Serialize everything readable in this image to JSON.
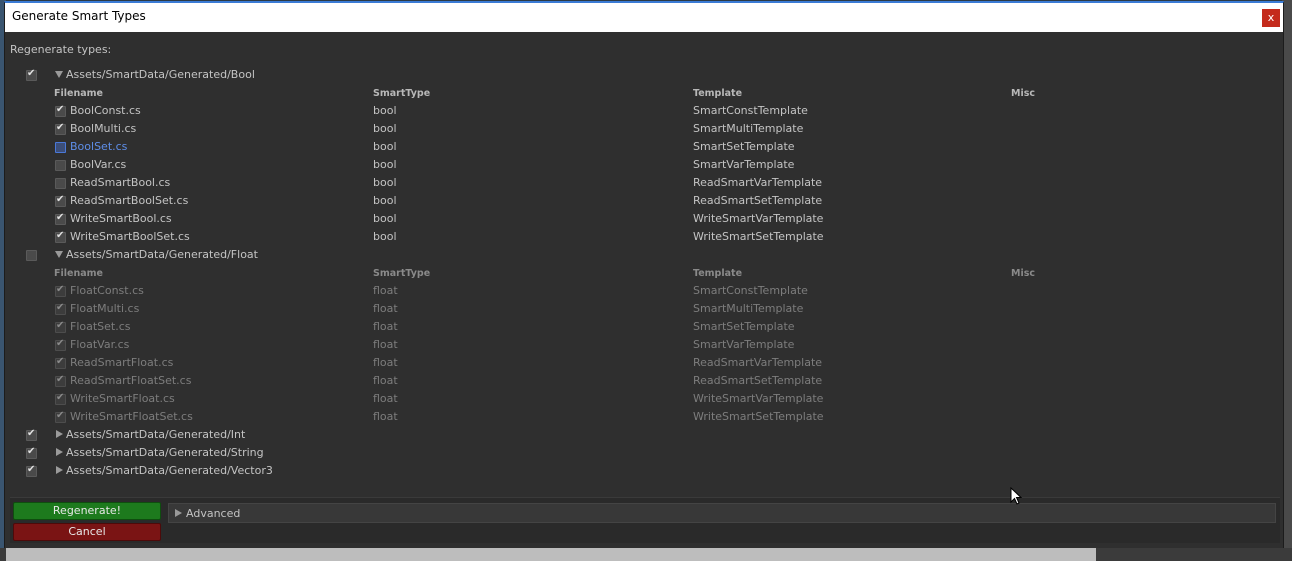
{
  "window": {
    "title": "Generate Smart Types",
    "close_label": "x"
  },
  "heading": "Regenerate types:",
  "columns": {
    "filename": "Filename",
    "smarttype": "SmartType",
    "template": "Template",
    "misc": "Misc"
  },
  "groups": [
    {
      "path": "Assets/SmartData/Generated/Bool",
      "checked": true,
      "expanded": true,
      "rows": [
        {
          "filename": "BoolConst.cs",
          "type": "bool",
          "template": "SmartConstTemplate",
          "checked": true
        },
        {
          "filename": "BoolMulti.cs",
          "type": "bool",
          "template": "SmartMultiTemplate",
          "checked": true
        },
        {
          "filename": "BoolSet.cs",
          "type": "bool",
          "template": "SmartSetTemplate",
          "checked": false
        },
        {
          "filename": "BoolVar.cs",
          "type": "bool",
          "template": "SmartVarTemplate",
          "checked": false
        },
        {
          "filename": "ReadSmartBool.cs",
          "type": "bool",
          "template": "ReadSmartVarTemplate",
          "checked": false
        },
        {
          "filename": "ReadSmartBoolSet.cs",
          "type": "bool",
          "template": "ReadSmartSetTemplate",
          "checked": true
        },
        {
          "filename": "WriteSmartBool.cs",
          "type": "bool",
          "template": "WriteSmartVarTemplate",
          "checked": true
        },
        {
          "filename": "WriteSmartBoolSet.cs",
          "type": "bool",
          "template": "WriteSmartSetTemplate",
          "checked": true
        }
      ]
    },
    {
      "path": "Assets/SmartData/Generated/Float",
      "checked": false,
      "expanded": true,
      "rows": [
        {
          "filename": "FloatConst.cs",
          "type": "float",
          "template": "SmartConstTemplate",
          "checked": true
        },
        {
          "filename": "FloatMulti.cs",
          "type": "float",
          "template": "SmartMultiTemplate",
          "checked": true
        },
        {
          "filename": "FloatSet.cs",
          "type": "float",
          "template": "SmartSetTemplate",
          "checked": true
        },
        {
          "filename": "FloatVar.cs",
          "type": "float",
          "template": "SmartVarTemplate",
          "checked": true
        },
        {
          "filename": "ReadSmartFloat.cs",
          "type": "float",
          "template": "ReadSmartVarTemplate",
          "checked": true
        },
        {
          "filename": "ReadSmartFloatSet.cs",
          "type": "float",
          "template": "ReadSmartSetTemplate",
          "checked": true
        },
        {
          "filename": "WriteSmartFloat.cs",
          "type": "float",
          "template": "WriteSmartVarTemplate",
          "checked": true
        },
        {
          "filename": "WriteSmartFloatSet.cs",
          "type": "float",
          "template": "WriteSmartSetTemplate",
          "checked": true
        }
      ]
    },
    {
      "path": "Assets/SmartData/Generated/Int",
      "checked": true,
      "expanded": false
    },
    {
      "path": "Assets/SmartData/Generated/String",
      "checked": true,
      "expanded": false
    },
    {
      "path": "Assets/SmartData/Generated/Vector3",
      "checked": true,
      "expanded": false
    }
  ],
  "buttons": {
    "regenerate": "Regenerate!",
    "cancel": "Cancel"
  },
  "advanced": {
    "label": "Advanced"
  },
  "colors": {
    "regenerate": "#1d7a1d",
    "cancel": "#7a1414",
    "accent": "#3a7bd5"
  }
}
